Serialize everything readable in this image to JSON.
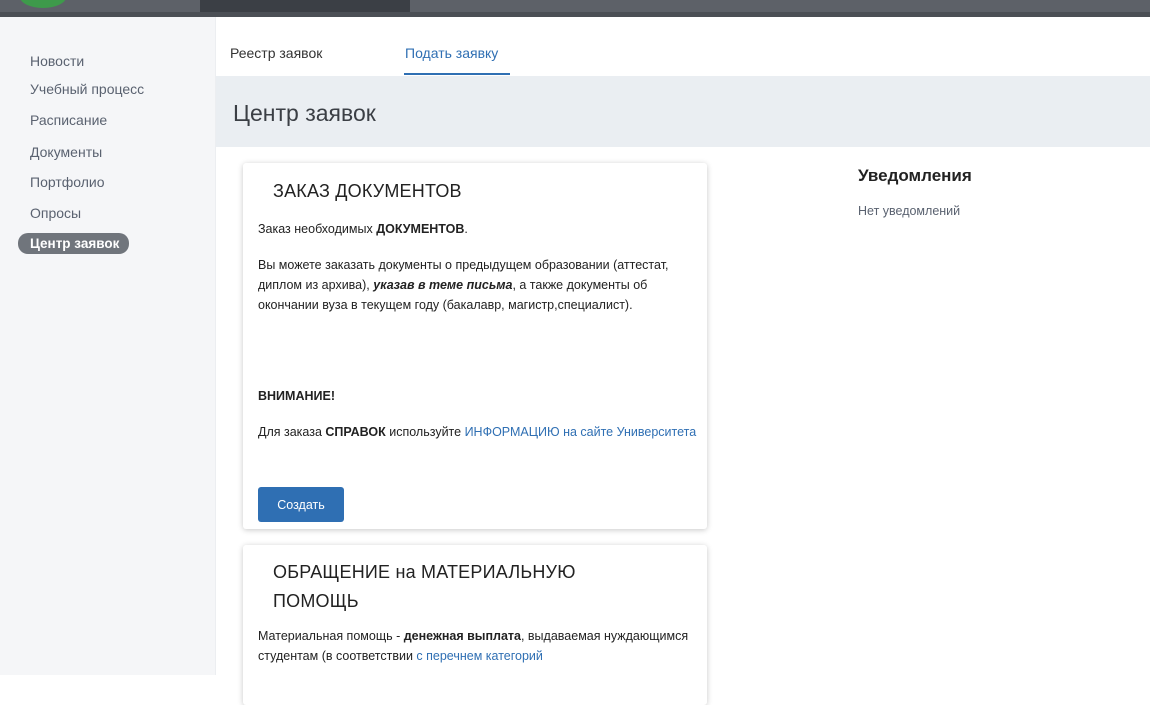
{
  "sidebar": {
    "items": [
      {
        "label": "Новости"
      },
      {
        "label": "Учебный процесс"
      },
      {
        "label": "Расписание"
      },
      {
        "label": "Документы"
      },
      {
        "label": "Портфолио"
      },
      {
        "label": "Опросы"
      },
      {
        "label": "Центр заявок",
        "active": true
      }
    ]
  },
  "tabs": [
    {
      "label": "Реестр заявок",
      "active": false
    },
    {
      "label": "Подать заявку",
      "active": true
    }
  ],
  "page_title": "Центр заявок",
  "cards": [
    {
      "title": "ЗАКАЗ ДОКУМЕНТОВ",
      "intro_prefix": "Заказ необходимых ",
      "intro_bold": "ДОКУМЕНТОВ",
      "intro_suffix": ".",
      "body_1": "Вы можете заказать документы о предыдущем образовании (аттестат, диплом из архива), ",
      "body_bold_italic": "указав в теме письма",
      "body_2": ", а также документы об окончании вуза в текущем году (бакалавр, магистр,специалист).",
      "warning": "ВНИМАНИЕ!",
      "note_prefix": "Для заказа ",
      "note_bold": "СПРАВОК",
      "note_middle": " используйте ",
      "note_link": "ИНФОРМАЦИЮ на сайте Университета",
      "button_label": "Создать"
    },
    {
      "title_line1": "ОБРАЩЕНИЕ на МАТЕРИАЛЬНУЮ",
      "title_line2": "ПОМОЩЬ",
      "body_prefix": "Материальная помощь - ",
      "body_bold": "денежная выплата",
      "body_middle": ", выдаваемая нуждающимся студентам (в соответствии ",
      "body_link": "с перечнем категорий"
    }
  ],
  "notifications": {
    "title": "Уведомления",
    "empty_text": "Нет уведомлений"
  },
  "colors": {
    "accent": "#2f6fb3",
    "sidebar_active_bg": "#70757c",
    "title_bar_bg": "#eaeef2",
    "top_bar_bg": "#5d6168"
  }
}
